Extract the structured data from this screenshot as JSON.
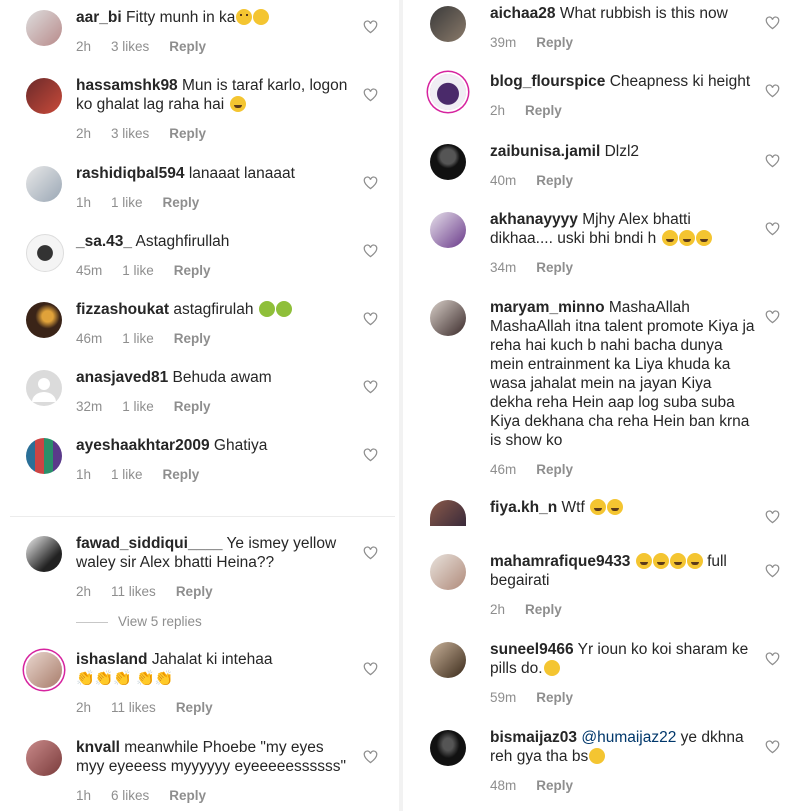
{
  "left": [
    {
      "user": "aar_bi",
      "text": "Fitty munh in ka",
      "emoji": "eyeroll-angry",
      "time": "2h",
      "likes": "3 likes",
      "reply": "Reply"
    },
    {
      "user": "hassamshk98",
      "text": "Mun is taraf karlo, logon ko ghalat lag raha hai",
      "emoji": "laugh",
      "time": "2h",
      "likes": "3 likes",
      "reply": "Reply"
    },
    {
      "user": "rashidiqbal594",
      "text": "lanaaat lanaaat",
      "time": "1h",
      "likes": "1 like",
      "reply": "Reply"
    },
    {
      "user": "_sa.43_",
      "text": "Astaghfirullah",
      "time": "45m",
      "likes": "1 like",
      "reply": "Reply"
    },
    {
      "user": "fizzashoukat",
      "text": "astagfirulah",
      "emoji": "sick",
      "time": "46m",
      "likes": "1 like",
      "reply": "Reply"
    },
    {
      "user": "anasjaved81",
      "text": "Behuda awam",
      "time": "32m",
      "likes": "1 like",
      "reply": "Reply"
    },
    {
      "user": "ayeshaakhtar2009",
      "text": "Ghatiya",
      "time": "1h",
      "likes": "1 like",
      "reply": "Reply"
    },
    {
      "user": "fawad_siddiqui____",
      "text": "Ye ismey yellow waley sir Alex bhatti Heina??",
      "time": "2h",
      "likes": "11 likes",
      "reply": "Reply"
    },
    {
      "user": "ishasland",
      "text": "Jahalat ki intehaa",
      "emoji": "claps",
      "time": "2h",
      "likes": "11 likes",
      "reply": "Reply"
    },
    {
      "user": "knvall",
      "text": "meanwhile Phoebe \"my eyes myy eyeeess myyyyyy eyeeeeessssss\"",
      "time": "1h",
      "likes": "6 likes",
      "reply": "Reply"
    }
  ],
  "view_replies": "View 5 replies",
  "right": [
    {
      "user": "aichaa28",
      "text": "What rubbish is this now",
      "time": "39m",
      "reply": "Reply"
    },
    {
      "user": "blog_flourspice",
      "text": "Cheapness ki height",
      "time": "2h",
      "reply": "Reply"
    },
    {
      "user": "zaibunisa.jamil",
      "text": "Dlzl2",
      "time": "40m",
      "reply": "Reply"
    },
    {
      "user": "akhanayyyy",
      "text": "Mjhy Alex bhatti dikhaa.... uski bhi bndi h",
      "emoji": "laugh3",
      "time": "34m",
      "reply": "Reply"
    },
    {
      "user": "maryam_minno",
      "text": "MashaAllah MashaAllah itna talent promote Kiya ja reha hai kuch b nahi bacha dunya mein entrainment ka Liya khuda ka wasa jahalat mein na jayan  Kiya dekha reha Hein aap log  suba suba Kiya dekhana cha reha Hein ban krna is show ko",
      "time": "46m",
      "reply": "Reply"
    },
    {
      "user": "fiya.kh_n",
      "text": "Wtf",
      "emoji": "laugh2",
      "time": "",
      "reply": ""
    },
    {
      "user": "mahamrafique9433",
      "text": "full begairati",
      "emoji": "laugh4",
      "time": "2h",
      "reply": "Reply"
    },
    {
      "user": "suneel9466",
      "text": "Yr ioun ko koi sharam ke pills do.",
      "emoji": "cry",
      "time": "59m",
      "reply": "Reply"
    },
    {
      "user": "bismaijaz03",
      "mention": "@humaijaz22",
      "text": "ye dkhna reh gya tha bs",
      "emoji": "sad",
      "time": "48m",
      "reply": "Reply"
    }
  ],
  "colors": {
    "username": "#262626",
    "meta": "#8e8e8e",
    "mention": "#00376b",
    "story_ring": "#d6249f"
  }
}
